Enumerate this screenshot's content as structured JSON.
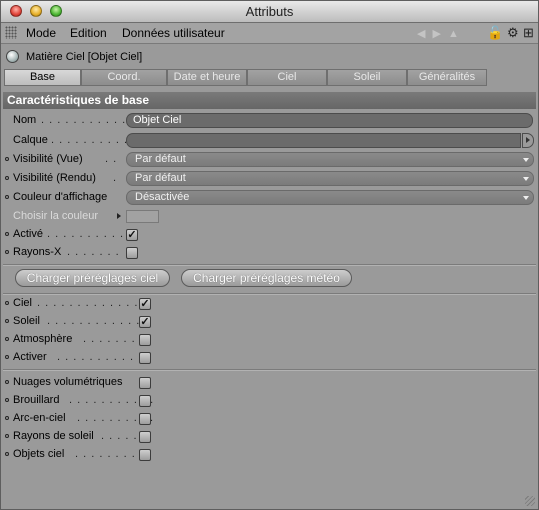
{
  "window": {
    "title": "Attributs"
  },
  "menu": {
    "items": [
      "Mode",
      "Edition",
      "Données utilisateur"
    ]
  },
  "object": {
    "label": "Matière Ciel [Objet Ciel]"
  },
  "tabs": [
    "Base",
    "Coord.",
    "Date et heure",
    "Ciel",
    "Soleil",
    "Généralités"
  ],
  "section": {
    "title": "Caractéristiques de base"
  },
  "fields": {
    "nom": {
      "label": "Nom",
      "value": "Objet Ciel"
    },
    "calque": {
      "label": "Calque",
      "value": ""
    },
    "vis_vue": {
      "label": "Visibilité (Vue)",
      "value": "Par défaut"
    },
    "vis_rendu": {
      "label": "Visibilité (Rendu)",
      "value": "Par défaut"
    },
    "couleur": {
      "label": "Couleur d'affichage",
      "value": "Désactivée"
    },
    "choisir": {
      "label": "Choisir la couleur"
    },
    "active": {
      "label": "Activé",
      "checked": true
    },
    "rayons_x": {
      "label": "Rayons-X",
      "checked": false
    }
  },
  "buttons": {
    "presets_ciel": "Charger préréglages ciel",
    "presets_meteo": "Charger préréglages météo"
  },
  "group1": [
    {
      "label": "Ciel",
      "checked": true
    },
    {
      "label": "Soleil",
      "checked": true
    },
    {
      "label": "Atmosphère",
      "checked": false
    },
    {
      "label": "Activer",
      "checked": false
    }
  ],
  "group2": [
    {
      "label": "Nuages volumétriques",
      "checked": false
    },
    {
      "label": "Brouillard",
      "checked": false
    },
    {
      "label": "Arc-en-ciel",
      "checked": false
    },
    {
      "label": "Rayons de soleil",
      "checked": false
    },
    {
      "label": "Objets ciel",
      "checked": false
    }
  ],
  "icons": {
    "lock": "lock-icon",
    "gear": "gear-icon",
    "add": "add-panel-icon",
    "nav": "nav-arrows-icon",
    "object": "sky-object-icon"
  },
  "colors": {
    "section_bg": "#6f6f6f",
    "panel_bg": "#9a9a9a",
    "active_tab": "#c8c8c8"
  }
}
